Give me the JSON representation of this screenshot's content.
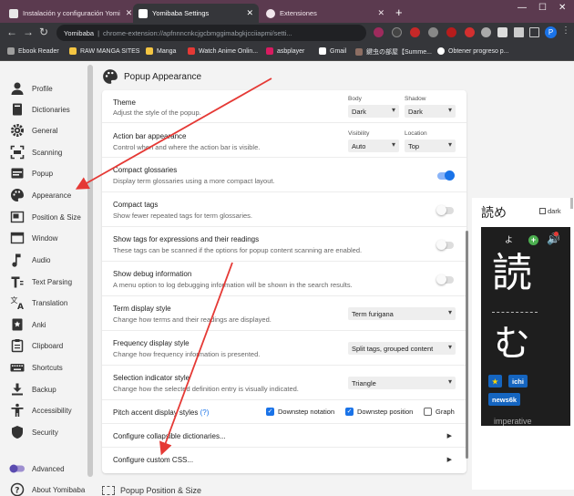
{
  "browser": {
    "tabs": [
      {
        "title": "Instalación y configuración Yomi",
        "favicon_color": "#e8e8e8",
        "active": false
      },
      {
        "title": "Yomibaba Settings",
        "favicon_color": "#ffffff",
        "active": true
      },
      {
        "title": "Extensiones",
        "favicon_color": "#f1e6ec",
        "active": false
      }
    ],
    "new_tab": "+",
    "window_controls": {
      "minimize": "—",
      "maximize": "☐",
      "close": "✕"
    },
    "nav": {
      "back": "←",
      "forward": "→",
      "reload": "↻"
    },
    "omnibox": {
      "site": "Yomibaba",
      "separator": "|",
      "url": "chrome-extension://apfnnncnkcjgcbmggimabgkjcciiapmi/setti..."
    },
    "profile_initial": "P",
    "bookmarks": [
      {
        "label": "Ebook Reader",
        "color": "#9e9e9e"
      },
      {
        "label": "RAW MANGA SITES",
        "color": "#f4c542"
      },
      {
        "label": "Manga",
        "color": "#f4c542"
      },
      {
        "label": "Watch Anime Onlin...",
        "color": "#e53935"
      },
      {
        "label": "asbplayer",
        "color": "#d81b60"
      },
      {
        "label": "Gmail",
        "color": "#ffffff"
      },
      {
        "label": "鍵虫の部屋【Summe...",
        "color": "#8d6e63"
      },
      {
        "label": "Obtener progreso p...",
        "color": "#ffffff"
      }
    ]
  },
  "sidebar": {
    "items": [
      {
        "label": "Profile",
        "icon": "person-icon"
      },
      {
        "label": "Dictionaries",
        "icon": "book-icon"
      },
      {
        "label": "General",
        "icon": "gear-icon"
      },
      {
        "label": "Scanning",
        "icon": "scan-icon"
      },
      {
        "label": "Popup",
        "icon": "popup-icon"
      },
      {
        "label": "Appearance",
        "icon": "palette-icon"
      },
      {
        "label": "Position & Size",
        "icon": "position-icon"
      },
      {
        "label": "Window",
        "icon": "window-icon"
      },
      {
        "label": "Audio",
        "icon": "audio-icon"
      },
      {
        "label": "Text Parsing",
        "icon": "text-parsing-icon"
      },
      {
        "label": "Translation",
        "icon": "translation-icon"
      },
      {
        "label": "Anki",
        "icon": "anki-icon"
      },
      {
        "label": "Clipboard",
        "icon": "clipboard-icon"
      },
      {
        "label": "Shortcuts",
        "icon": "keyboard-icon"
      },
      {
        "label": "Backup",
        "icon": "backup-icon"
      },
      {
        "label": "Accessibility",
        "icon": "accessibility-icon"
      },
      {
        "label": "Security",
        "icon": "shield-icon"
      },
      {
        "label": "Advanced",
        "icon": "toggle-icon"
      },
      {
        "label": "About Yomibaba",
        "icon": "help-icon"
      }
    ]
  },
  "section": {
    "title": "Popup Appearance",
    "next_title": "Popup Position & Size"
  },
  "settings": {
    "theme": {
      "title": "Theme",
      "desc": "Adjust the style of the popup.",
      "body_label": "Body",
      "body_value": "Dark",
      "shadow_label": "Shadow",
      "shadow_value": "Dark"
    },
    "action_bar": {
      "title": "Action bar appearance",
      "desc": "Control when and where the action bar is visible.",
      "visibility_label": "Visibility",
      "visibility_value": "Auto",
      "location_label": "Location",
      "location_value": "Top"
    },
    "compact_glossaries": {
      "title": "Compact glossaries",
      "desc": "Display term glossaries using a more compact layout.",
      "enabled": true
    },
    "compact_tags": {
      "title": "Compact tags",
      "desc": "Show fewer repeated tags for term glossaries.",
      "enabled": false
    },
    "show_tags": {
      "title": "Show tags for expressions and their readings",
      "desc": "These tags can be scanned if the options for popup content scanning are enabled.",
      "enabled": false
    },
    "debug": {
      "title": "Show debug information",
      "desc": "A menu option to log debugging information will be shown in the search results.",
      "enabled": false
    },
    "term_display": {
      "title": "Term display style",
      "desc": "Change how terms and their readings are displayed.",
      "value": "Term furigana"
    },
    "frequency_display": {
      "title": "Frequency display style",
      "desc": "Change how frequency information is presented.",
      "value": "Split tags, grouped content"
    },
    "selection_indicator": {
      "title": "Selection indicator style",
      "desc": "Change how the selected definition entry is visually indicated.",
      "value": "Triangle"
    },
    "pitch_accent": {
      "title": "Pitch accent display styles",
      "help": "(?)",
      "options": [
        {
          "label": "Downstep notation",
          "checked": true
        },
        {
          "label": "Downstep position",
          "checked": true
        },
        {
          "label": "Graph",
          "checked": false
        }
      ]
    },
    "configure_collapsible": {
      "title": "Configure collapsible dictionaries..."
    },
    "configure_css": {
      "title": "Configure custom CSS..."
    }
  },
  "preview": {
    "reading": "読め",
    "dark_label": "dark",
    "furigana": "よ",
    "kanji": "読",
    "kana": "む",
    "tags": [
      {
        "label": "★",
        "bg": "#1565c0",
        "fg": "#ffd600"
      },
      {
        "label": "ichi",
        "bg": "#1565c0",
        "fg": "#ffffff"
      },
      {
        "label": "news6k",
        "bg": "#1565c0",
        "fg": "#ffffff"
      }
    ],
    "part_of_speech": "imperative"
  },
  "colors": {
    "accent": "#1a73e8",
    "arrow": "#e53935",
    "chrome_tab_bg": "#5b3a4f",
    "chrome_toolbar": "#35363a"
  }
}
